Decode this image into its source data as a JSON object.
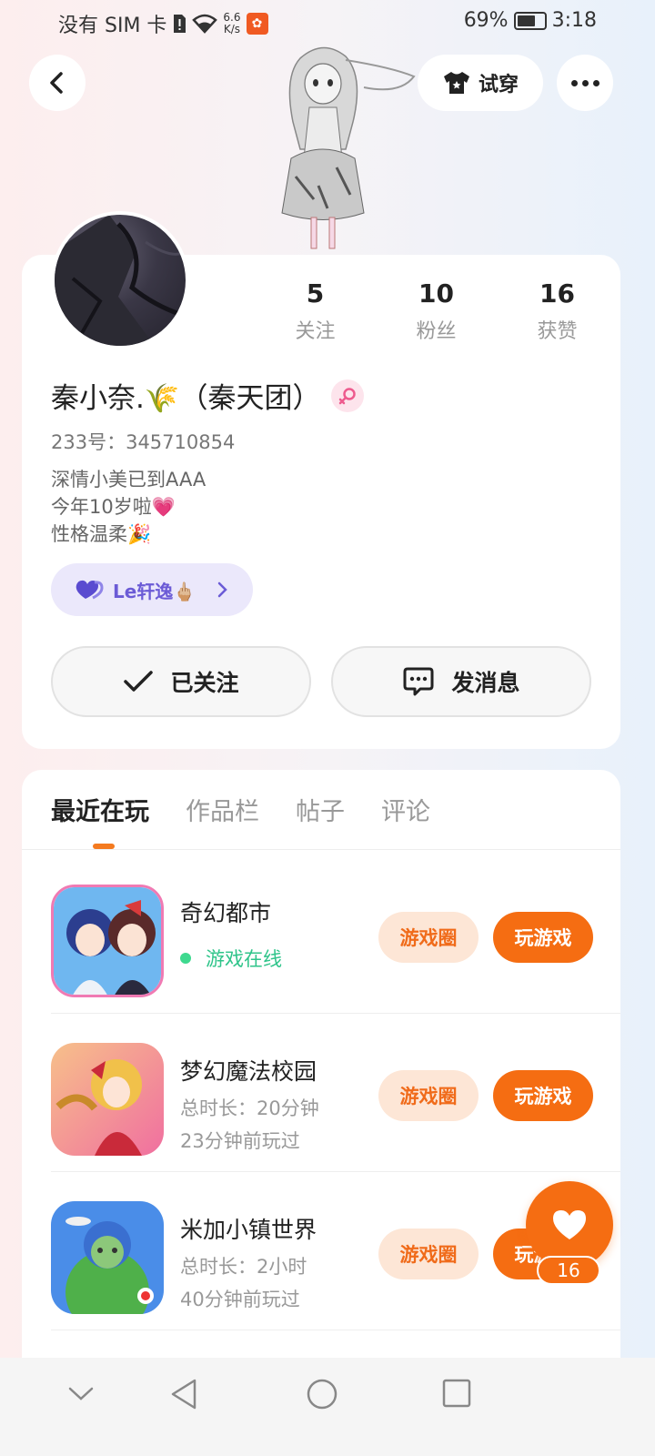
{
  "status_bar": {
    "carrier": "没有 SIM 卡",
    "net_speed_value": "6.6",
    "net_speed_unit": "K/s",
    "battery": "69%",
    "battery_level": 0.69,
    "time": "3:18"
  },
  "header": {
    "try_on_label": "试穿"
  },
  "profile": {
    "stats": [
      {
        "value": "5",
        "label": "关注"
      },
      {
        "value": "10",
        "label": "粉丝"
      },
      {
        "value": "16",
        "label": "获赞"
      }
    ],
    "nickname": "秦小奈.🌾（秦天团）",
    "user_id": "233号：345710854",
    "bio": [
      "深情小美已到AAA",
      "今年10岁啦💗",
      "性格温柔🎉"
    ],
    "fan_chip_label": "Le轩逸🖕🏼",
    "followed_label": "已关注",
    "message_label": "发消息"
  },
  "tabs": [
    "最近在玩",
    "作品栏",
    "帖子",
    "评论"
  ],
  "games": [
    {
      "name": "奇幻都市",
      "status": "游戏在线",
      "circle_label": "游戏圈",
      "play_label": "玩游戏"
    },
    {
      "name": "梦幻魔法校园",
      "duration": "总时长：20分钟",
      "last_played": "23分钟前玩过",
      "circle_label": "游戏圈",
      "play_label": "玩游戏"
    },
    {
      "name": "米加小镇世界",
      "duration": "总时长：2小时",
      "last_played": "40分钟前玩过",
      "circle_label": "游戏圈",
      "play_label": "玩游戏"
    }
  ],
  "like_fab": {
    "count": "16"
  },
  "colors": {
    "accent": "#f56d12",
    "online": "#2fc48a",
    "chip": "#6b5bd6"
  }
}
